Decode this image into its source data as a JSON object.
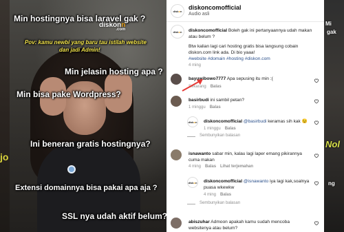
{
  "video": {
    "brand_main": "diskon",
    "brand_accent": "n",
    "brand_sub": ".com",
    "captions": [
      "Min hostingnya bisa laravel gak ?",
      "Pov: kamu newbi yang baru tau istilah website",
      "dan jadi Admin!",
      "Min jelasin hosting apa ?",
      "Min bisa pake Wordpress?",
      "Ini beneran gratis hostingnya?",
      "Extensi domainnya bisa pakai apa aja ?",
      "SSL nya udah aktif belum?"
    ]
  },
  "left_strip": {
    "text": "jo"
  },
  "right_strip": {
    "t1": "Mi",
    "t2": "gak",
    "t3": "Nol",
    "t4": "ng"
  },
  "header": {
    "username": "diskoncomofficial",
    "subtitle": "Audio asli"
  },
  "caption": {
    "username": "diskoncomofficial",
    "text1": " Boleh gak ini pertanyaannya udah makan atau belum ?",
    "text2": "Btw kalian lagi cari hosting gratis bisa langsung cobain diskon.com link ada. Di bio yaaa!",
    "hashtags": "#website #domain #hosting #diskon.com",
    "time": "4 ming"
  },
  "comments": [
    {
      "user": "bayuwibowo7777",
      "text": " Apa sepusing itu min :(",
      "time": "Sekarang",
      "reply": "Balas"
    },
    {
      "user": "basirbudi",
      "text": " ini sambil petan?",
      "time": "1 minggu",
      "reply": "Balas"
    },
    {
      "user": "diskoncomofficial",
      "mention": "@basirbudi",
      "text": " keramas sih kak 😉",
      "time": "1 minggu",
      "reply": "Balas"
    },
    {
      "hidden": "Sembunyikan balasan"
    },
    {
      "user": "isnawanto",
      "text": " sabar min, kalau lagi laper emang pikirannya cuma makan",
      "time": "4 ming",
      "reply": "Balas",
      "more": "Lihat terjemahan"
    },
    {
      "user": "diskoncomofficial",
      "mention": "@isnawanto",
      "text": " iya lagi kak,soalnya puasa wkewkw",
      "time": "4 ming",
      "reply": "Balas"
    },
    {
      "hidden": "Sembunyikan balasan"
    },
    {
      "user": "abiszuhar",
      "text": " Admoon apakah kamu sudah mencoba websitenya atau belum?",
      "time": "",
      "reply": ""
    }
  ],
  "colors": {
    "accent": "#f0a71d",
    "link": "#2a4f8a",
    "arrow": "#e53935"
  }
}
